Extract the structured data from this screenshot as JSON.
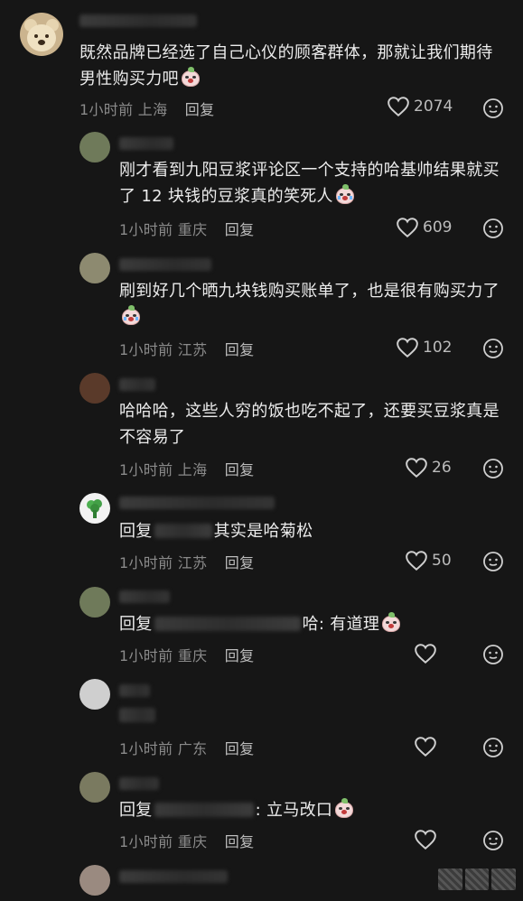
{
  "comments": [
    {
      "text": "既然品牌已经选了自己心仪的顾客群体，那就让我们期待男性购买力吧",
      "time": "1小时前",
      "location": "上海",
      "reply_label": "回复",
      "likes": "2074",
      "avatar_icon": "teddy-bear-avatar"
    },
    {
      "text": "刚才看到九阳豆浆评论区一个支持的哈基帅结果就买了 12 块钱的豆浆真的笑死人",
      "time": "1小时前",
      "location": "重庆",
      "reply_label": "回复",
      "likes": "609"
    },
    {
      "text": "刷到好几个晒九块钱购买账单了，也是很有购买力了",
      "time": "1小时前",
      "location": "江苏",
      "reply_label": "回复",
      "likes": "102"
    },
    {
      "text": "哈哈哈，这些人穷的饭也吃不起了，还要买豆浆真是不容易了",
      "time": "1小时前",
      "location": "上海",
      "reply_label": "回复",
      "likes": "26"
    },
    {
      "prefix": "回复",
      "text": "其实是哈菊松",
      "time": "1小时前",
      "location": "江苏",
      "reply_label": "回复",
      "likes": "50"
    },
    {
      "prefix": "回复",
      "text": "哈: 有道理",
      "time": "1小时前",
      "location": "重庆",
      "reply_label": "回复",
      "likes": ""
    },
    {
      "time": "1小时前",
      "location": "广东",
      "reply_label": "回复",
      "likes": ""
    },
    {
      "prefix": "回复",
      "text": ": 立马改口",
      "time": "1小时前",
      "location": "重庆",
      "reply_label": "回复",
      "likes": ""
    }
  ],
  "colors": {
    "background": "#161616",
    "text": "#ececec",
    "meta": "#8a8a8a"
  }
}
